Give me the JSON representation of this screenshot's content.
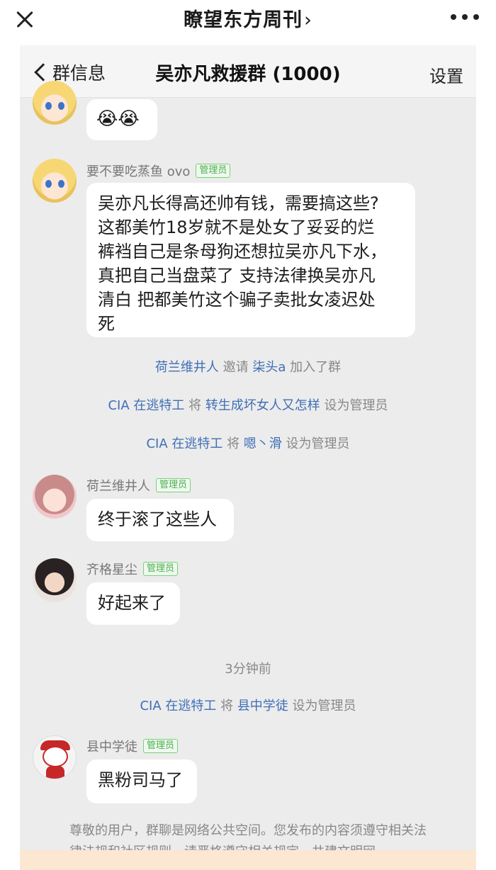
{
  "outer": {
    "title": "瞭望东方周刊",
    "chevron": "›",
    "close_icon": "close-icon",
    "more_icon": "more-icon"
  },
  "inner": {
    "back_label": "群信息",
    "title": "吴亦凡救援群 (1000)",
    "settings_label": "设置"
  },
  "messages": [
    {
      "emoji": "😭😭"
    },
    {
      "sender": "要不要吃蒸鱼 ovo",
      "badge": "管理员",
      "lines": [
        "吴亦凡长得高还帅有钱，需要搞这些?",
        "这都美竹18岁就不是处女了妥妥的烂",
        "裤裆自己是条母狗还想拉吴亦凡下水，",
        "真把自己当盘菜了 支持法律换吴亦凡",
        "清白 把都美竹这个骗子卖批女凌迟处",
        "死"
      ]
    },
    {
      "sender": "荷兰维井人",
      "badge": "管理员",
      "text": "终于滚了这些人"
    },
    {
      "sender": "齐格星尘",
      "badge": "管理员",
      "text": "好起来了"
    },
    {
      "sender": "县中学徒",
      "badge": "管理员",
      "text": "黑粉司马了"
    }
  ],
  "system": [
    {
      "a": "荷兰维井人",
      "mid": " 邀请 ",
      "b": "柒头a",
      "end": " 加入了群"
    },
    {
      "a": "CIA 在逃特工",
      "mid": " 将 ",
      "b": "转生成坏女人又怎样",
      "end": " 设为管理员"
    },
    {
      "a": "CIA 在逃特工",
      "mid": " 将 ",
      "b": "嗯丶滑",
      "end": " 设为管理员"
    },
    {
      "time": "3分钟前"
    },
    {
      "a": "CIA 在逃特工",
      "mid": " 将 ",
      "b": "县中学徒",
      "end": " 设为管理员"
    }
  ],
  "notice": "尊敬的用户，群聊是网络公共空间。您发布的内容须遵守相关法律法规和社区规则，请严格遵守相关规定，共建文明网"
}
